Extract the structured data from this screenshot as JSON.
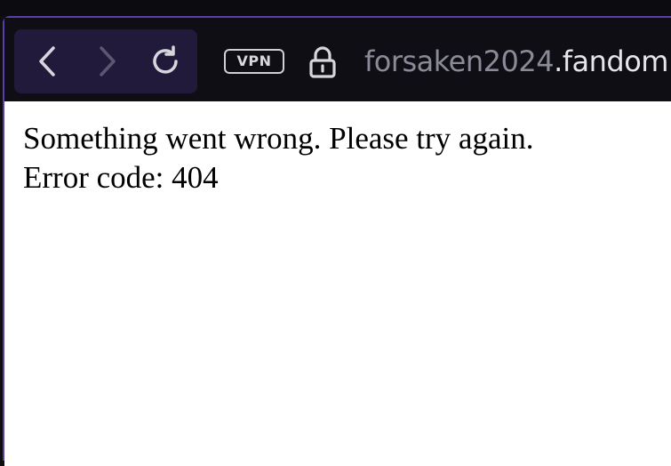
{
  "toolbar": {
    "back_icon": "chevron-left-icon",
    "forward_icon": "chevron-right-icon",
    "reload_icon": "reload-icon",
    "vpn_label": "VPN",
    "lock_icon": "lock-icon",
    "url_subdomain": "forsaken2024",
    "url_domain": ".fandom."
  },
  "page": {
    "message": "Something went wrong. Please try again.",
    "error_code": "Error code: 404"
  },
  "colors": {
    "frame_accent": "#5b3fa8",
    "nav_group_bg": "#221a3b",
    "toolbar_bg": "#0f0e14",
    "url_dim": "#8a8a99",
    "url_bright": "#e6e6ea"
  }
}
